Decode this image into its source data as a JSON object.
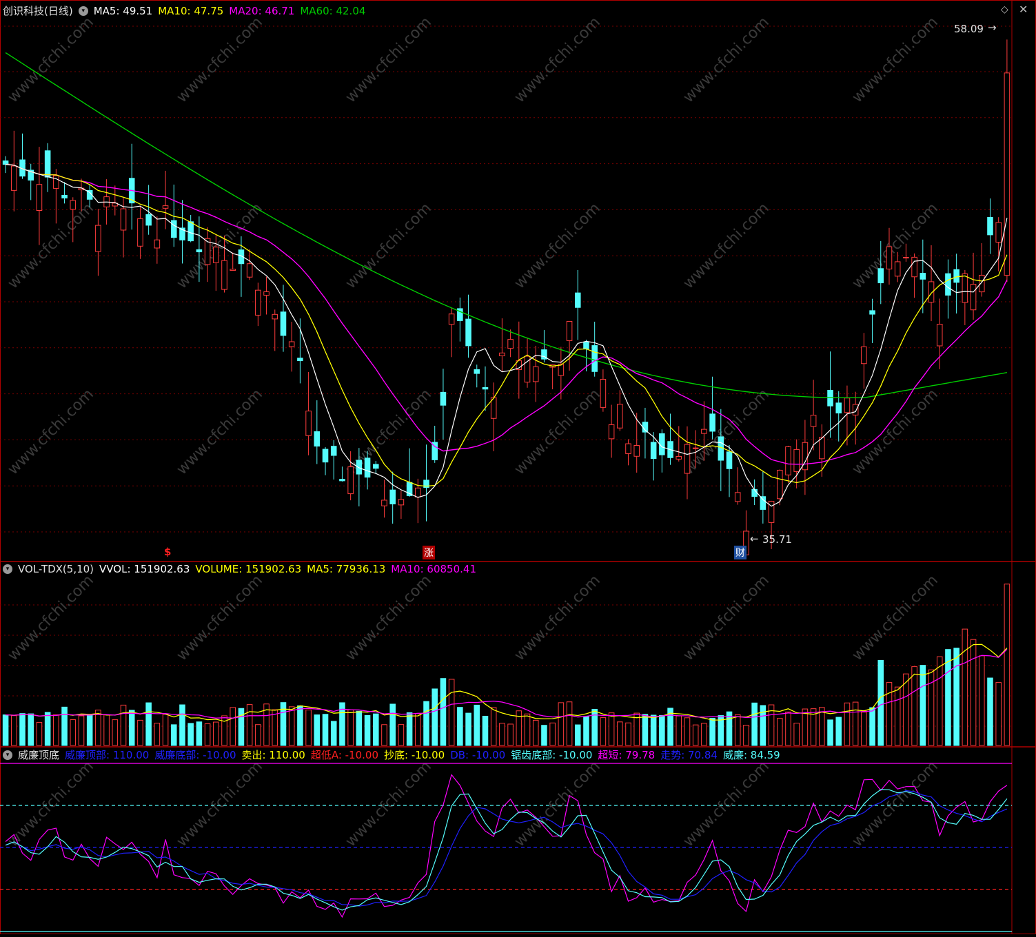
{
  "colors": {
    "up": "#ff3c3c",
    "down": "#54fcfc",
    "ma5": "#ffffff",
    "ma10": "#ffff00",
    "ma20": "#ff00ff",
    "ma60": "#00cc00",
    "grid": "#7a0000",
    "border": "#b00000"
  },
  "main": {
    "stock": "创识科技(日线)",
    "indicators": [
      {
        "label": "MA5: 49.51",
        "color": "#ffffff"
      },
      {
        "label": "MA10: 47.75",
        "color": "#ffff00"
      },
      {
        "label": "MA20: 46.71",
        "color": "#ff00ff"
      },
      {
        "label": "MA60: 42.04",
        "color": "#00cc00"
      }
    ],
    "high_label": "58.09",
    "low_label": "35.71",
    "markers": [
      {
        "text": "$",
        "color": "#ff2020"
      },
      {
        "text": "涨",
        "color": "#ffffff",
        "bg": "#b00000"
      },
      {
        "text": "财",
        "color": "#ffffff",
        "bg": "#2050a0"
      }
    ]
  },
  "volume": {
    "name": "VOL-TDX(5,10)",
    "items": [
      {
        "label": "VVOL: 151902.63",
        "color": "#ffffff"
      },
      {
        "label": "VOLUME: 151902.63",
        "color": "#ffff00"
      },
      {
        "label": "MA5: 77936.13",
        "color": "#ffff00"
      },
      {
        "label": "MA10: 60850.41",
        "color": "#ff00ff"
      }
    ]
  },
  "indicator": {
    "name": "威廉顶底",
    "items": [
      {
        "label": "威廉顶部: 110.00",
        "color": "#2020ff"
      },
      {
        "label": "威廉底部: -10.00",
        "color": "#2020ff"
      },
      {
        "label": "卖出: 110.00",
        "color": "#ffff00"
      },
      {
        "label": "超低A: -10.00",
        "color": "#ff2020"
      },
      {
        "label": "抄底: -10.00",
        "color": "#ffff00"
      },
      {
        "label": "DB: -10.00",
        "color": "#2020ff"
      },
      {
        "label": "锯齿底部: -10.00",
        "color": "#54fcfc"
      },
      {
        "label": "超短: 79.78",
        "color": "#ff00ff"
      },
      {
        "label": "走势: 70.84",
        "color": "#2020ff"
      },
      {
        "label": "威廉: 84.59",
        "color": "#54fcfc"
      }
    ]
  },
  "watermark": "www.cfchi.com",
  "chart_data": {
    "type": "candlestick",
    "price_range": [
      35.71,
      58.09
    ],
    "last_close": 58.09,
    "ma_last": {
      "ma5": 49.51,
      "ma10": 47.75,
      "ma20": 46.71,
      "ma60": 42.04
    },
    "volume_last": 151902.63,
    "williams_reference_levels": [
      110,
      80,
      50,
      20,
      -10
    ]
  }
}
